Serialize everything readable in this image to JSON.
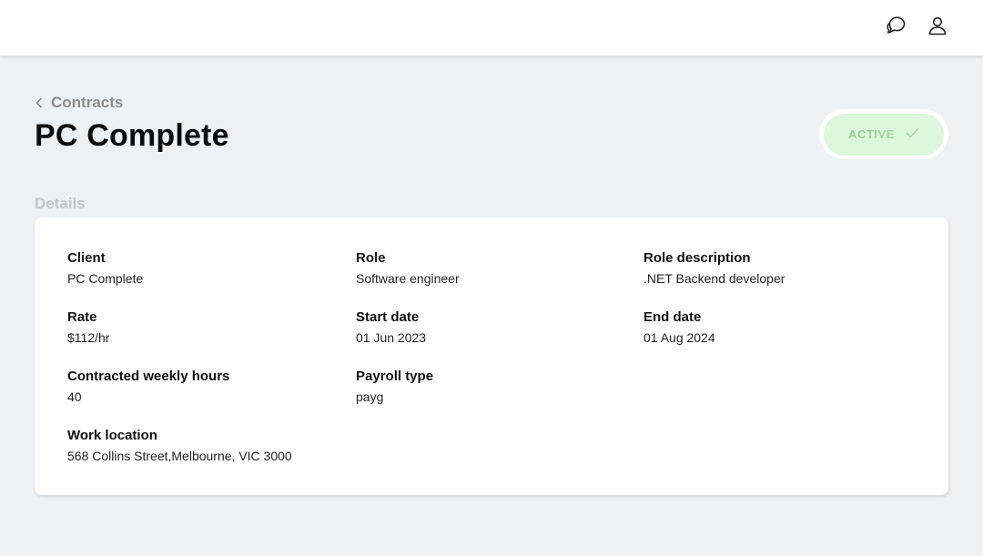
{
  "header": {
    "icons": [
      "chat-icon",
      "user-icon"
    ]
  },
  "breadcrumb": {
    "label": "Contracts"
  },
  "page": {
    "title": "PC Complete"
  },
  "status": {
    "label": "ACTIVE",
    "color_bg": "#dcf8dc",
    "color_text": "#9fcea0"
  },
  "details": {
    "section_label": "Details",
    "fields": {
      "client": {
        "label": "Client",
        "value": "PC Complete"
      },
      "role": {
        "label": "Role",
        "value": "Software engineer"
      },
      "role_description": {
        "label": "Role description",
        "value": ".NET Backend developer"
      },
      "rate": {
        "label": "Rate",
        "value": "$112/hr"
      },
      "start_date": {
        "label": "Start date",
        "value": "01 Jun 2023"
      },
      "end_date": {
        "label": "End date",
        "value": "01 Aug 2024"
      },
      "weekly_hours": {
        "label": "Contracted weekly hours",
        "value": "40"
      },
      "payroll_type": {
        "label": "Payroll type",
        "value": "payg"
      },
      "work_location": {
        "label": "Work location",
        "value": "568 Collins Street,Melbourne, VIC 3000"
      }
    }
  }
}
